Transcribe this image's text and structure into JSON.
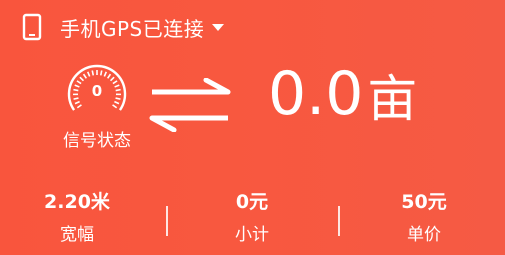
{
  "header": {
    "connection_text": "手机GPS已连接"
  },
  "signal": {
    "value": "0",
    "label": "信号状态"
  },
  "area": {
    "value": "0.0",
    "unit": "亩"
  },
  "stats": [
    {
      "value": "2.20米",
      "label": "宽幅"
    },
    {
      "value": "0元",
      "label": "小计"
    },
    {
      "value": "50元",
      "label": "单价"
    }
  ],
  "colors": {
    "background": "#f8583f",
    "foreground": "#ffffff"
  },
  "icons": {
    "device": "phone-icon",
    "dropdown": "caret-down-icon",
    "gauge": "gauge-icon",
    "swap": "swap-arrows-icon"
  }
}
